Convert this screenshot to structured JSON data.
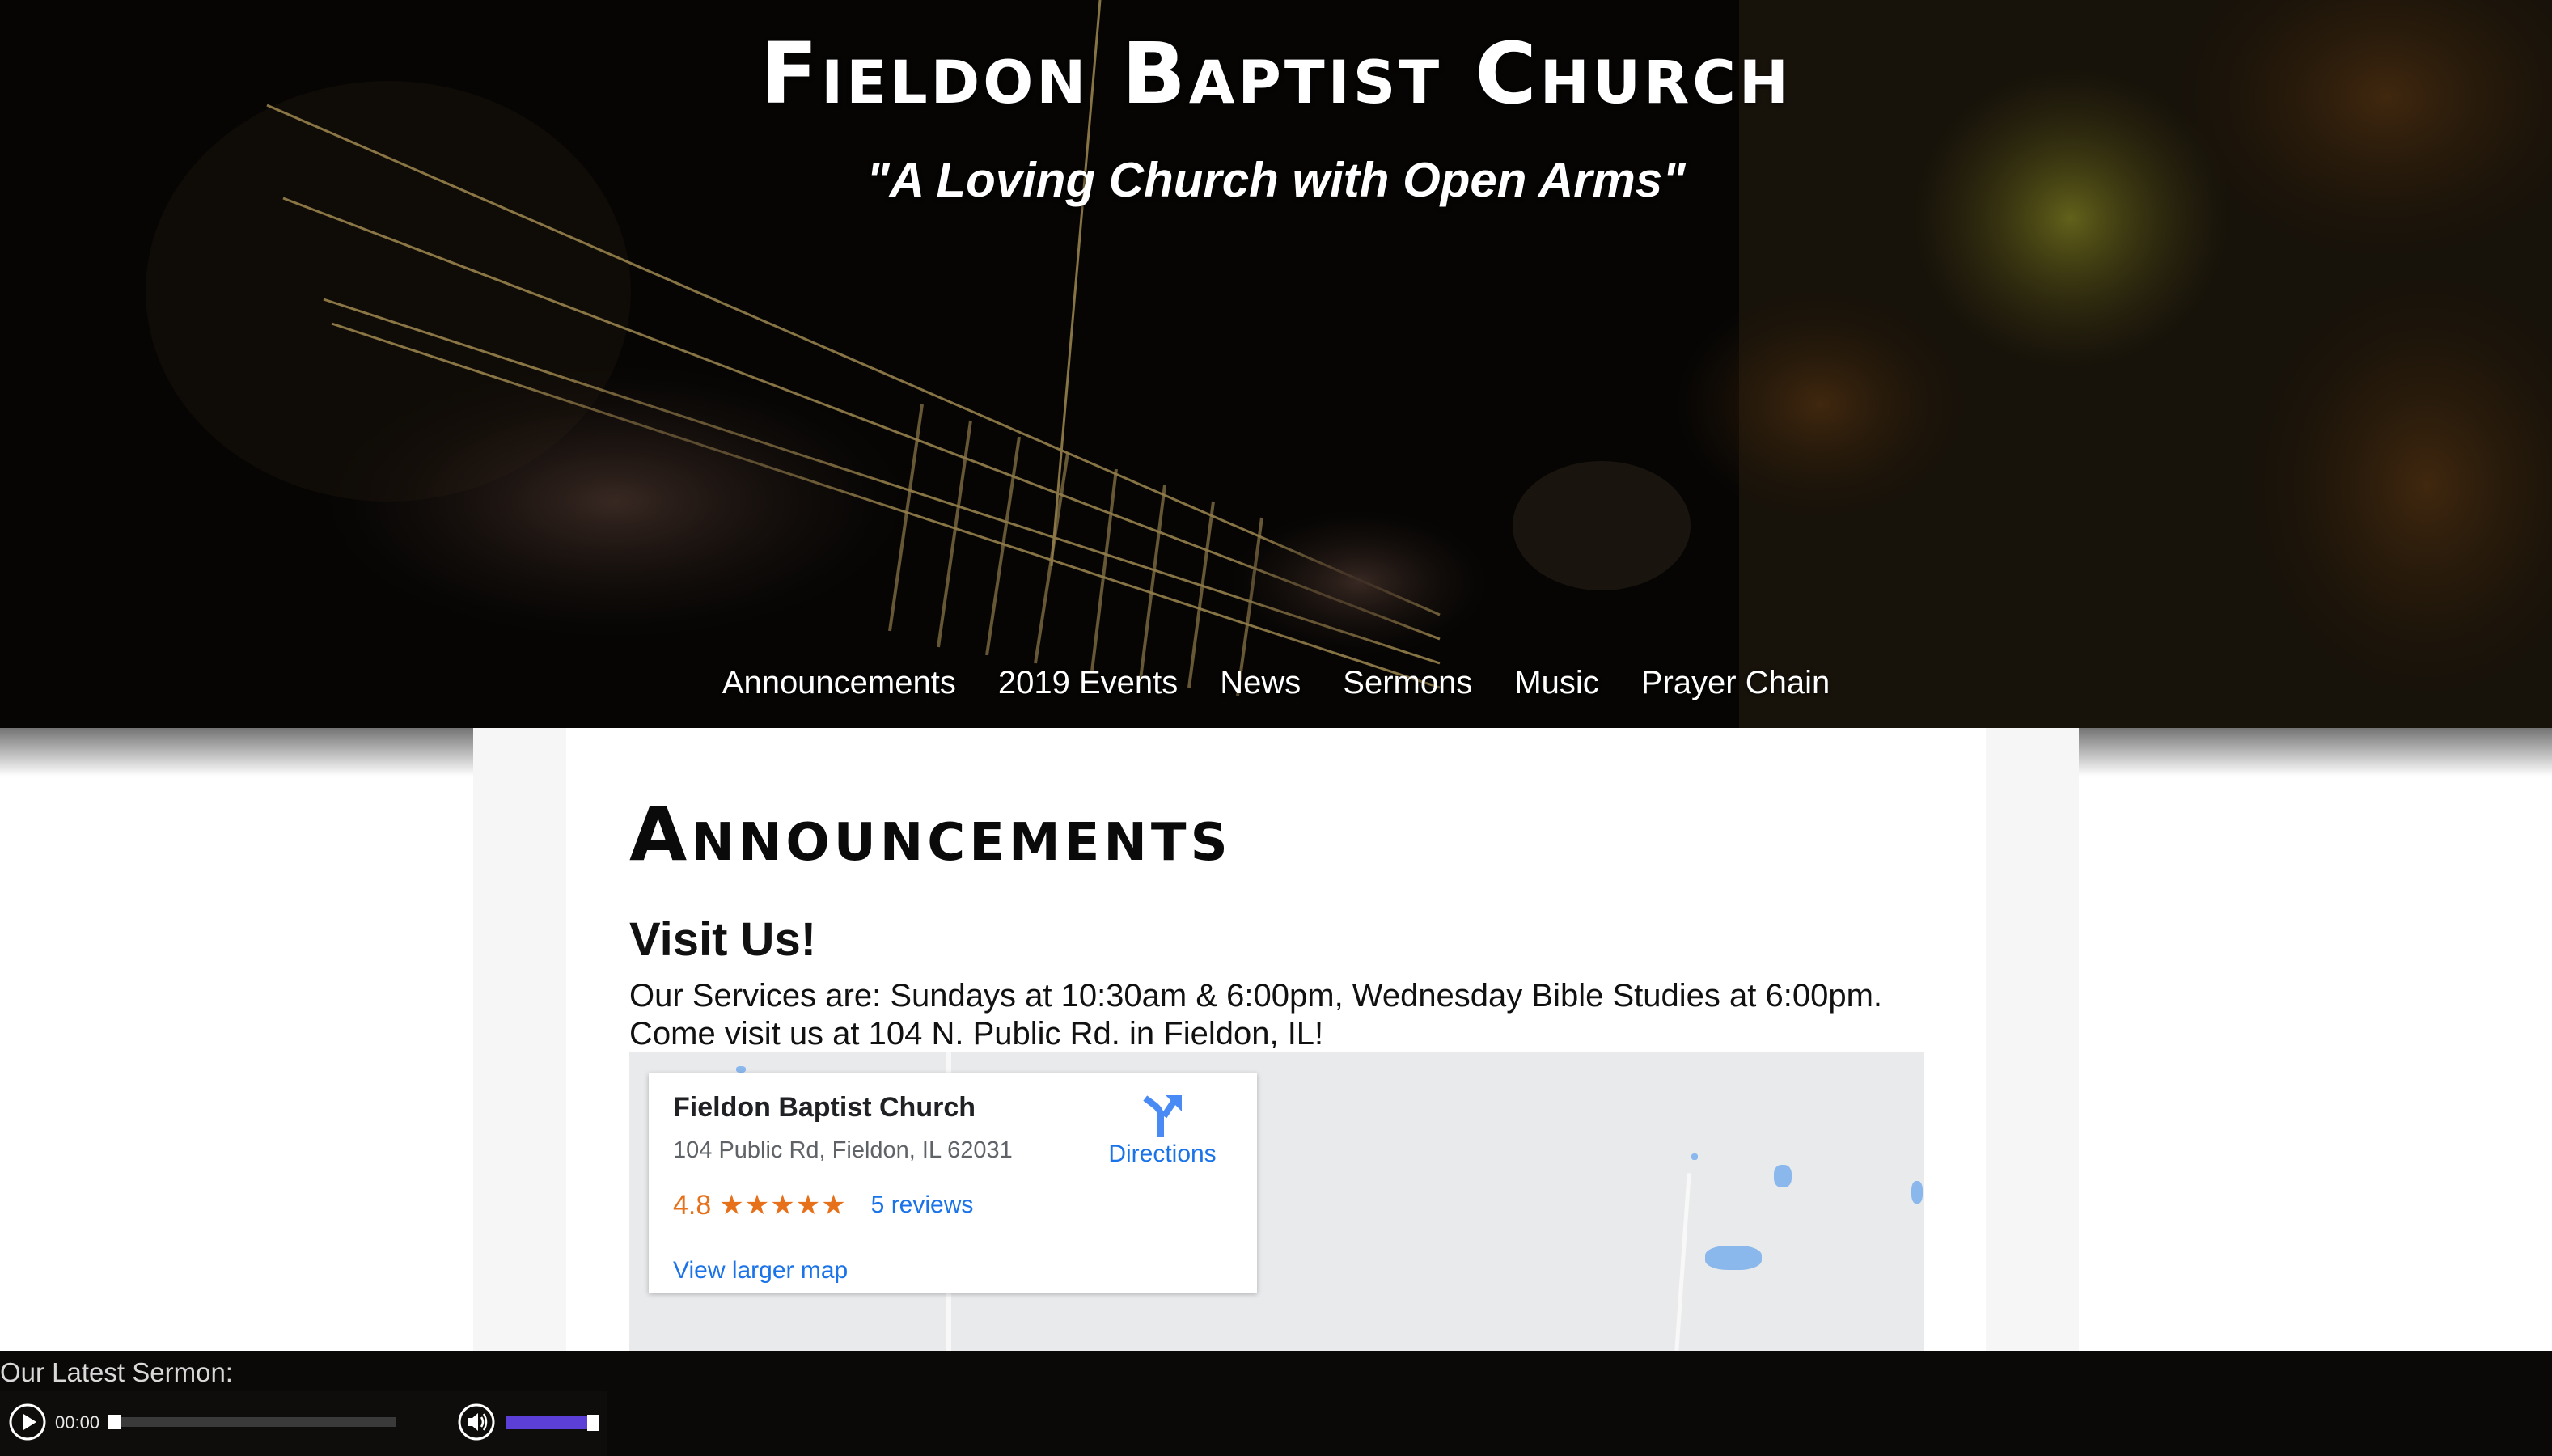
{
  "header": {
    "title": "Fieldon Baptist Church",
    "tagline": "\"A Loving Church with Open Arms\"",
    "background_icon": "guitar-photo"
  },
  "nav": {
    "items": [
      {
        "label": "Announcements"
      },
      {
        "label": "2019 Events"
      },
      {
        "label": "News"
      },
      {
        "label": "Sermons"
      },
      {
        "label": "Music"
      },
      {
        "label": "Prayer Chain"
      }
    ]
  },
  "main": {
    "heading": "Announcements",
    "visit_heading": "Visit Us!",
    "services_text": "Our Services are: Sundays at 10:30am & 6:00pm, Wednesday Bible Studies at 6:00pm. Come visit us at 104 N. Public Rd. in Fieldon, IL!"
  },
  "map": {
    "place_name": "Fieldon Baptist Church",
    "address": "104 Public Rd, Fieldon, IL 62031",
    "rating": "4.8",
    "stars": "★★★★★",
    "reviews": "5 reviews",
    "directions_label": "Directions",
    "larger_map_label": "View larger map",
    "colors": {
      "link": "#1a73e8",
      "rating": "#e7711b"
    }
  },
  "sermon_player": {
    "title": "Our Latest Sermon:",
    "time": "00:00",
    "progress_fraction": 0.0,
    "volume_fraction": 0.9,
    "colors": {
      "volume": "#5b3fd6"
    }
  }
}
